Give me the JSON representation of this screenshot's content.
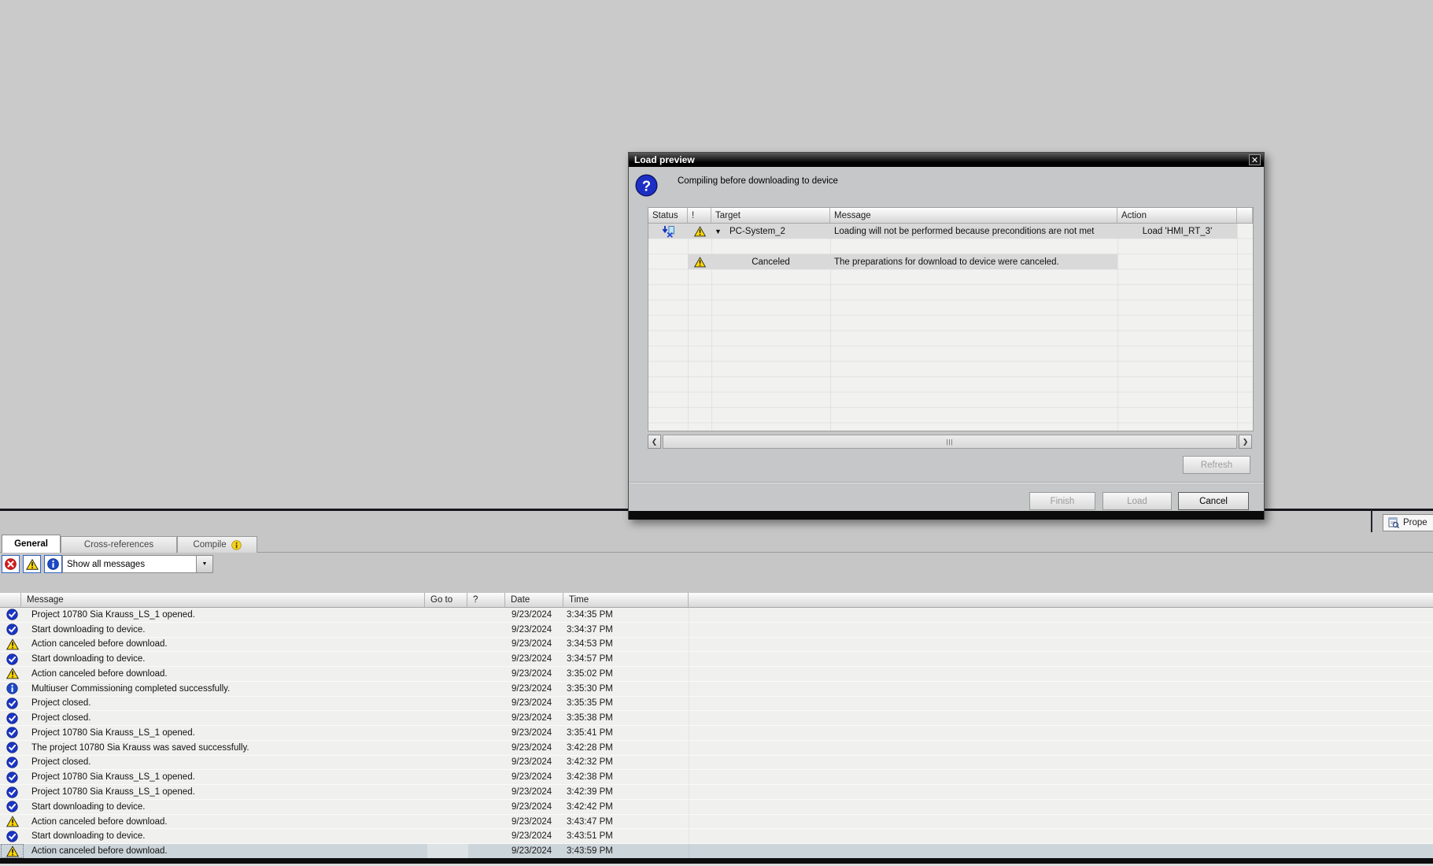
{
  "dialog": {
    "title": "Load preview",
    "subtitle": "Compiling before downloading to device",
    "columns": [
      "Status",
      "!",
      "Target",
      "Message",
      "Action"
    ],
    "rows": [
      {
        "status_icon": "download-canceled-icon",
        "alert_icon": "warning-icon",
        "expander": "▼",
        "target": "PC-System_2",
        "message": "Loading will not be performed because preconditions are not met",
        "action": "Load 'HMI_RT_3'"
      },
      {
        "status_icon": "",
        "alert_icon": "warning-icon",
        "expander": "",
        "target": "Canceled",
        "message": "The preparations for download to device were canceled.",
        "action": ""
      }
    ],
    "refresh_label": "Refresh",
    "finish_label": "Finish",
    "load_label": "Load",
    "cancel_label": "Cancel"
  },
  "inspector": {
    "properties_tab_label": "Prope",
    "tabs": [
      {
        "label": "General",
        "active": true
      },
      {
        "label": "Cross-references",
        "active": false
      },
      {
        "label": "Compile",
        "active": false,
        "badge_icon": "yellow-info-icon"
      }
    ],
    "filters": [
      {
        "icon": "error-filter-icon"
      },
      {
        "icon": "warning-filter-icon"
      },
      {
        "icon": "info-filter-icon"
      }
    ],
    "message_filter_value": "Show all messages",
    "messages": {
      "columns": [
        "Message",
        "Go to",
        "?",
        "Date",
        "Time"
      ],
      "rows": [
        {
          "icon": "success-icon",
          "text": "Project 10780 Sia Krauss_LS_1 opened.",
          "date": "9/23/2024",
          "time": "3:34:35 PM",
          "selected": false
        },
        {
          "icon": "success-icon",
          "text": "Start downloading to device.",
          "date": "9/23/2024",
          "time": "3:34:37 PM",
          "selected": false
        },
        {
          "icon": "warning-icon",
          "text": "Action canceled before download.",
          "date": "9/23/2024",
          "time": "3:34:53 PM",
          "selected": false
        },
        {
          "icon": "success-icon",
          "text": "Start downloading to device.",
          "date": "9/23/2024",
          "time": "3:34:57 PM",
          "selected": false
        },
        {
          "icon": "warning-icon",
          "text": "Action canceled before download.",
          "date": "9/23/2024",
          "time": "3:35:02 PM",
          "selected": false
        },
        {
          "icon": "info-icon",
          "text": "Multiuser Commissioning completed successfully.",
          "date": "9/23/2024",
          "time": "3:35:30 PM",
          "selected": false
        },
        {
          "icon": "success-icon",
          "text": "Project closed.",
          "date": "9/23/2024",
          "time": "3:35:35 PM",
          "selected": false
        },
        {
          "icon": "success-icon",
          "text": "Project closed.",
          "date": "9/23/2024",
          "time": "3:35:38 PM",
          "selected": false
        },
        {
          "icon": "success-icon",
          "text": "Project 10780 Sia Krauss_LS_1 opened.",
          "date": "9/23/2024",
          "time": "3:35:41 PM",
          "selected": false
        },
        {
          "icon": "success-icon",
          "text": "The project 10780 Sia Krauss was saved successfully.",
          "date": "9/23/2024",
          "time": "3:42:28 PM",
          "selected": false
        },
        {
          "icon": "success-icon",
          "text": "Project closed.",
          "date": "9/23/2024",
          "time": "3:42:32 PM",
          "selected": false
        },
        {
          "icon": "success-icon",
          "text": "Project 10780 Sia Krauss_LS_1 opened.",
          "date": "9/23/2024",
          "time": "3:42:38 PM",
          "selected": false
        },
        {
          "icon": "success-icon",
          "text": "Project 10780 Sia Krauss_LS_1 opened.",
          "date": "9/23/2024",
          "time": "3:42:39 PM",
          "selected": false
        },
        {
          "icon": "success-icon",
          "text": "Start downloading to device.",
          "date": "9/23/2024",
          "time": "3:42:42 PM",
          "selected": false
        },
        {
          "icon": "warning-icon",
          "text": "Action canceled before download.",
          "date": "9/23/2024",
          "time": "3:43:47 PM",
          "selected": false
        },
        {
          "icon": "success-icon",
          "text": "Start downloading to device.",
          "date": "9/23/2024",
          "time": "3:43:51 PM",
          "selected": false
        },
        {
          "icon": "warning-icon",
          "text": "Action canceled before download.",
          "date": "9/23/2024",
          "time": "3:43:59 PM",
          "selected": true
        }
      ]
    }
  },
  "colors": {
    "accent_blue": "#1b35c4",
    "warning_yellow": "#ffd800",
    "error_red": "#d41c1c",
    "selection_gray_blue": "#ccd5da"
  }
}
